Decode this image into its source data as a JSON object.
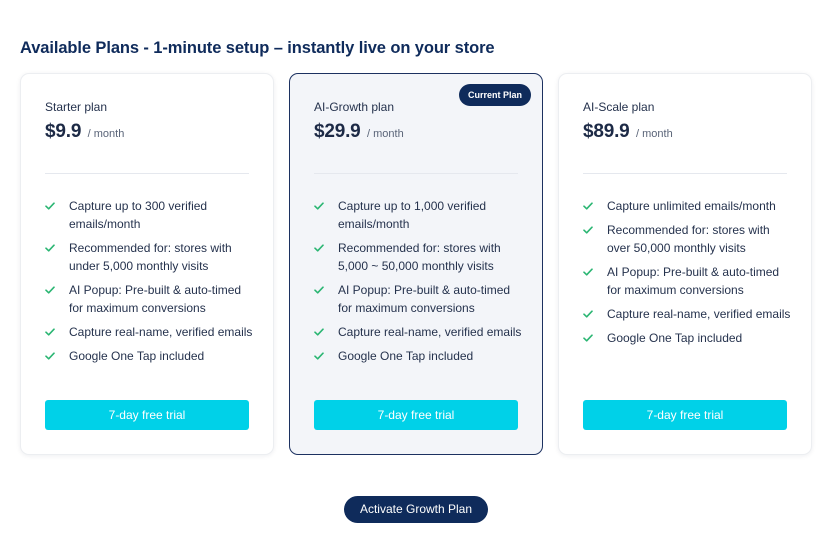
{
  "heading": "Available Plans - 1-minute setup – instantly live on your store",
  "colors": {
    "accent": "#00d1e8",
    "navy": "#0f2b5b",
    "check": "#2bb673"
  },
  "plans": [
    {
      "name": "Starter plan",
      "price": "$9.9",
      "period": "/ month",
      "badge": null,
      "features": [
        "Capture up to 300 verified emails/month",
        "Recommended for: stores with under 5,000 monthly visits",
        "AI Popup: Pre-built & auto-timed for maximum conversions",
        "Capture real-name, verified emails",
        "Google One Tap included"
      ],
      "cta": "7-day free trial"
    },
    {
      "name": "AI-Growth plan",
      "price": "$29.9",
      "period": "/ month",
      "badge": "Current Plan",
      "features": [
        "Capture up to 1,000 verified emails/month",
        "Recommended for: stores with 5,000 ~ 50,000 monthly visits",
        "AI Popup: Pre-built & auto-timed for maximum conversions",
        "Capture real-name, verified emails",
        "Google One Tap included"
      ],
      "cta": "7-day free trial"
    },
    {
      "name": "AI-Scale plan",
      "price": "$89.9",
      "period": "/ month",
      "badge": null,
      "features": [
        "Capture unlimited emails/month",
        "Recommended for: stores with over 50,000 monthly visits",
        "AI Popup: Pre-built & auto-timed for maximum conversions",
        "Capture real-name, verified emails",
        "Google One Tap included"
      ],
      "cta": "7-day free trial"
    }
  ],
  "activate_button": "Activate Growth Plan",
  "icons": {
    "feature_check": "check-icon"
  }
}
